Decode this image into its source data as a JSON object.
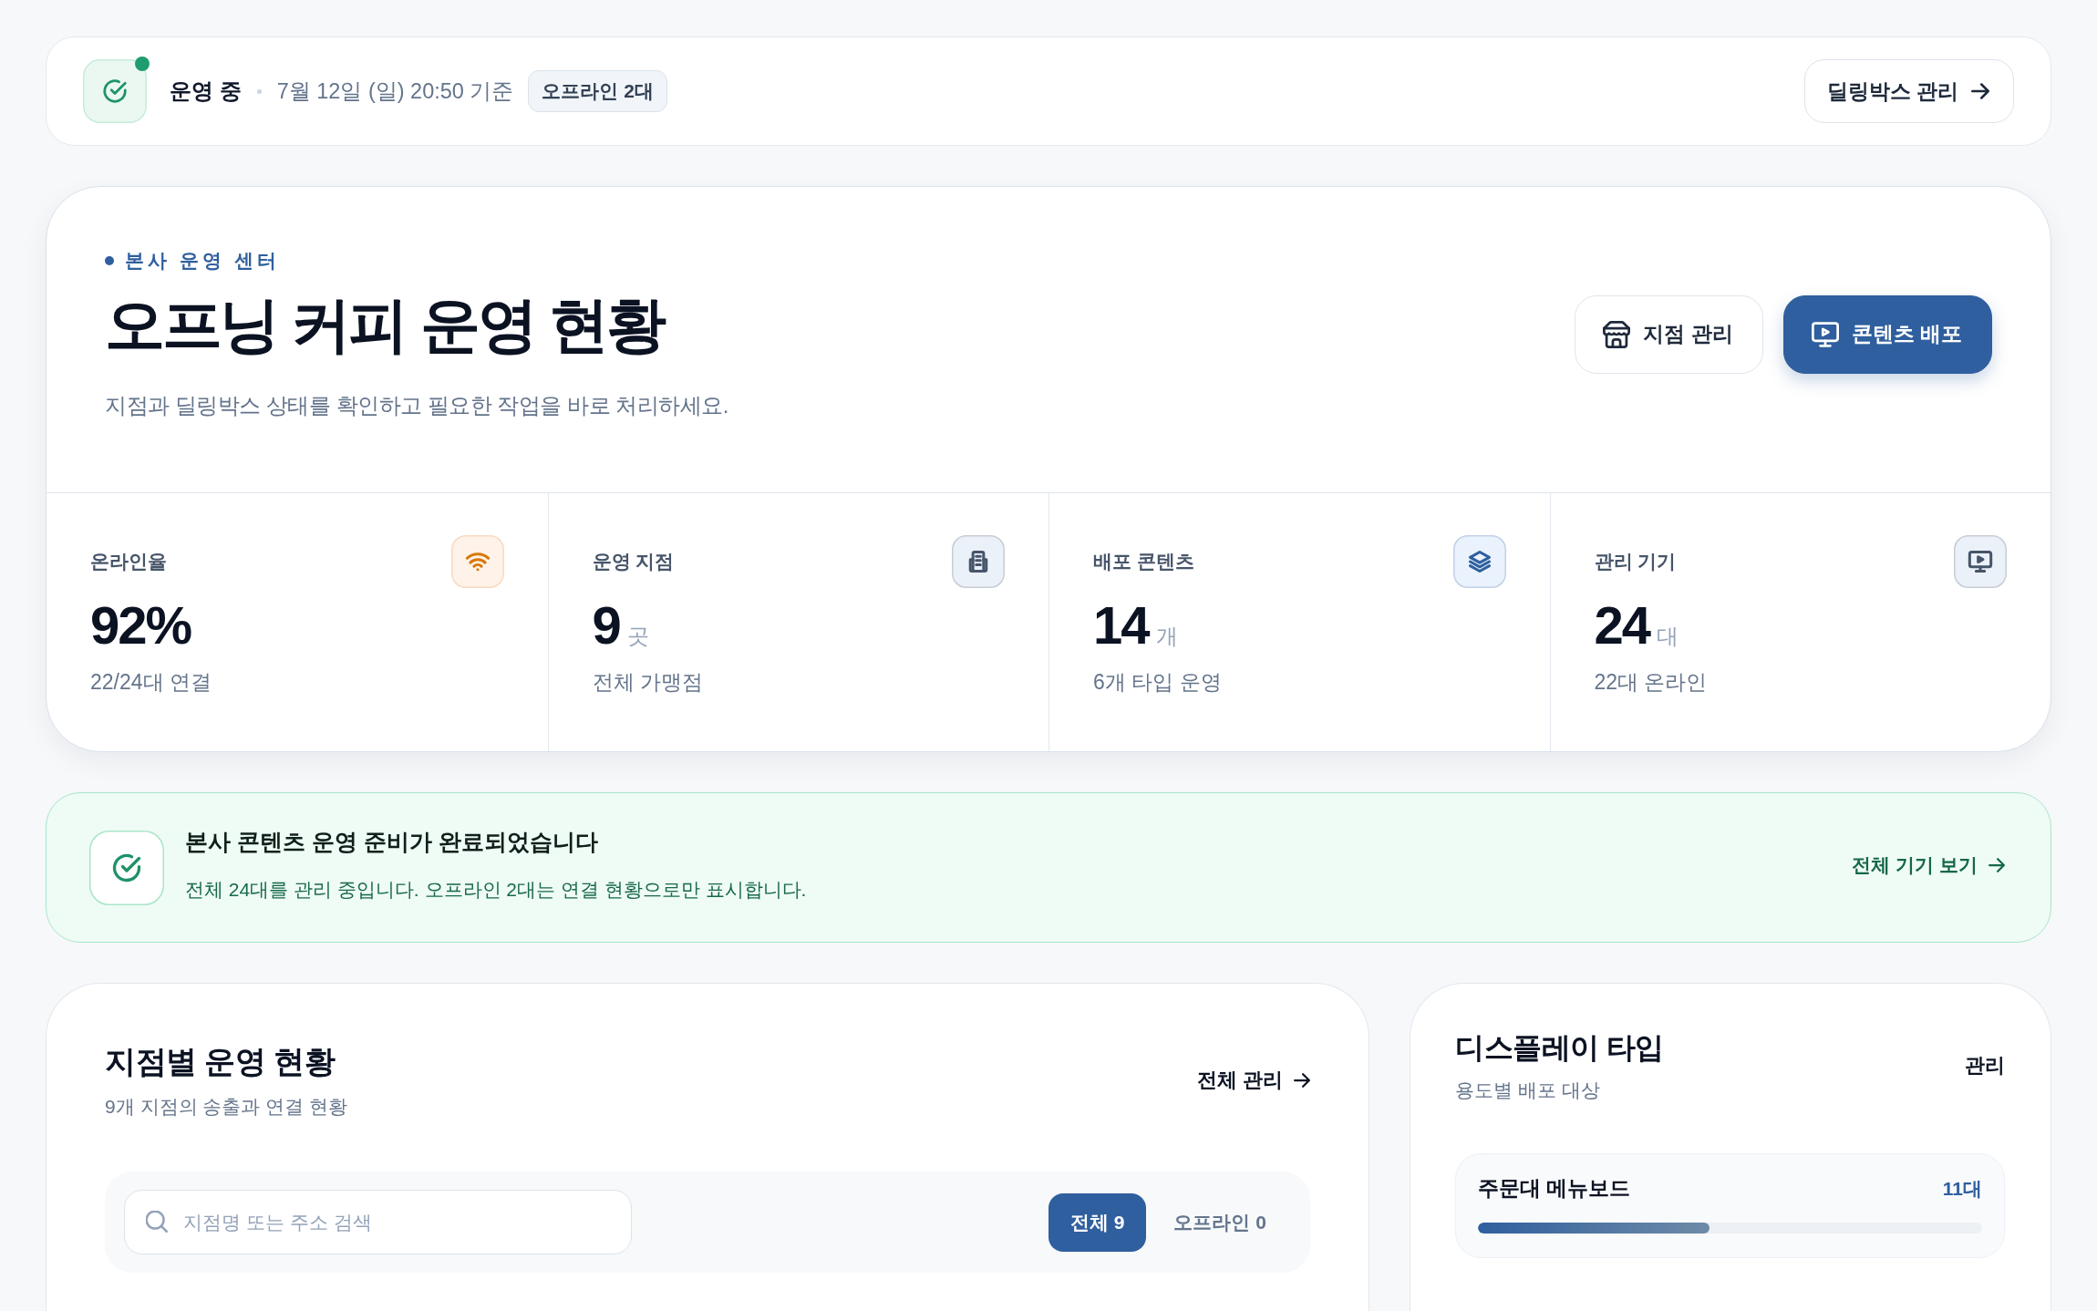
{
  "status_bar": {
    "status": {
      "label": "운영 중",
      "online": true
    },
    "updated": "7월 12일 (일) 20:50 기준",
    "badge": "오프라인 2대",
    "action": "딜링박스 관리"
  },
  "hero": {
    "eyebrow": "본사 운영 센터",
    "title": "오프닝 커피 운영 현황",
    "subtitle": "지점과 딜링박스 상태를 확인하고 필요한 작업을 바로 처리하세요.",
    "buttons": [
      {
        "label": "지점 관리",
        "kind": "secondary"
      },
      {
        "label": "콘텐츠 배포",
        "kind": "primary"
      }
    ],
    "stats": [
      {
        "label": "온라인율",
        "value": "92%",
        "detail": "22/24대 연결",
        "color": "#d97706"
      },
      {
        "label": "운영 지점",
        "value": "9",
        "unit": "곳",
        "detail": "전체 가맹점",
        "color": "#475569"
      },
      {
        "label": "배포 콘텐츠",
        "value": "14",
        "unit": "개",
        "detail": "6개 타입 운영",
        "color": "#2f5f9e"
      },
      {
        "label": "관리 기기",
        "value": "24",
        "unit": "대",
        "detail": "22대 온라인",
        "color": "#475569"
      }
    ]
  },
  "notice": {
    "title": "본사 콘텐츠 운영 준비가 완료되었습니다",
    "message": "전체 24대를 관리 중입니다. 오프라인 2대는 연결 현황으로만 표시합니다.",
    "link": "전체 기기 보기"
  },
  "stores_panel": {
    "title": "지점별 운영 현황",
    "subtitle": "9개 지점의 송출과 연결 현황",
    "link": "전체 관리",
    "search": {
      "placeholder": "지점명 또는 주소 검색"
    },
    "filters": [
      {
        "label": "전체 9",
        "selected": true
      },
      {
        "label": "오프라인 0",
        "selected": false
      }
    ]
  },
  "display_panel": {
    "title": "디스플레이 타입",
    "subtitle": "용도별 배포 대상",
    "link": "관리",
    "types": [
      {
        "name": "주문대 메뉴보드",
        "count": "11대",
        "level": 0.46
      }
    ]
  }
}
